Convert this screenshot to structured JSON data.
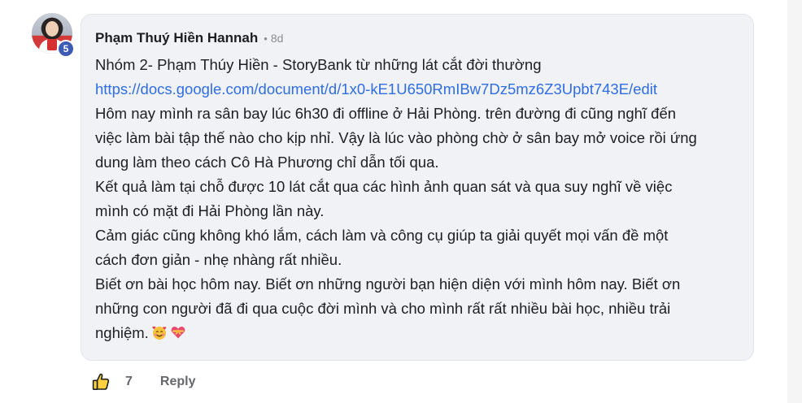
{
  "comment": {
    "author": "Phạm Thuý Hiền Hannah",
    "separator": "•",
    "time": "8d",
    "badge_level": "5",
    "lines": [
      "Nhóm 2- Phạm Thúy Hiền - StoryBank từ những lát cắt đời thường",
      "Hôm nay mình ra sân bay lúc 6h30 đi offline ở Hải Phòng. trên đường đi cũng nghĩ đến",
      "việc làm bài tập thế nào cho kịp nhỉ. Vậy là lúc vào phòng chờ ở sân bay mở voice rồi ứng",
      "dung làm theo cách Cô Hà Phương chỉ dẫn tối qua.",
      "Kết quả làm tại chỗ được 10 lát cắt qua các hình ảnh quan sát và qua suy nghĩ về việc",
      "mình có mặt đi Hải Phòng lần này.",
      "Cảm giác cũng không khó lắm, cách làm và công cụ giúp ta giải quyết mọi vấn đề một",
      "cách đơn giản - nhẹ nhàng rất nhiều.",
      "Biết ơn bài học hôm nay. Biết ơn những người bạn hiện diện với mình hôm nay. Biết ơn",
      "những con người đã đi qua cuộc đời mình và cho mình rất rất nhiều bài học, nhiều trải",
      "nghiệm."
    ],
    "link": "https://docs.google.com/document/d/1x0-kE1U650RmIBw7Dz5mz6Z3Upbt743E/edit",
    "emojis": [
      "smiling-face-with-hearts",
      "heart-with-ribbon"
    ]
  },
  "actions": {
    "like_icon": "thumbs-up-icon",
    "like_count": "7",
    "reply_label": "Reply"
  },
  "colors": {
    "link": "#2f6de1",
    "bubble_bg": "#f0f2f5",
    "badge_bg": "#3d5ab4"
  }
}
